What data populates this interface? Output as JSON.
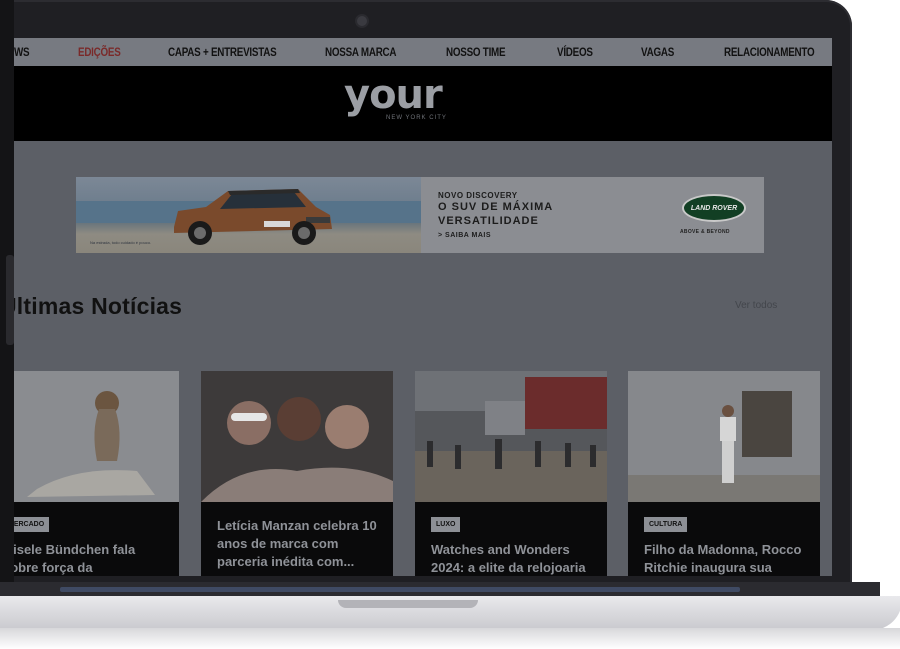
{
  "nav": {
    "items": [
      "WS",
      "EDIÇÕES",
      "CAPAS + ENTREVISTAS",
      "NOSSA MARCA",
      "NOSSO TIME",
      "VÍDEOS",
      "VAGAS",
      "RELACIONAMENTO"
    ],
    "active_index": 1
  },
  "header": {
    "logo": "your",
    "logo_sub": "NEW YORK CITY"
  },
  "ad": {
    "caption": "Na estrada, todo cuidado é pouco.",
    "line1": "NOVO DISCOVERY",
    "line2": "O SUV DE MÁXIMA",
    "line3": "VERSATILIDADE",
    "cta": "> SAIBA MAIS",
    "brand": "LAND ROVER",
    "brand_tag": "ABOVE & BEYOND"
  },
  "section": {
    "title": "Últimas Notícias",
    "see_all": "Ver todos"
  },
  "cards": [
    {
      "tag": "MERCADO",
      "title": "Gisele Bündchen fala sobre força da maternidade em"
    },
    {
      "tag": "",
      "title": "Letícia Manzan celebra 10 anos de marca com parceria inédita com..."
    },
    {
      "tag": "LUXO",
      "title": "Watches and Wonders 2024: a elite da relojoaria"
    },
    {
      "tag": "CULTURA",
      "title": "Filho da Madonna, Rocco Ritchie inaugura sua"
    }
  ],
  "colors": {
    "screen_overlay": "#5c5f66",
    "card_bg": "#0a0a0b",
    "active_nav": "#7a2a2a"
  }
}
